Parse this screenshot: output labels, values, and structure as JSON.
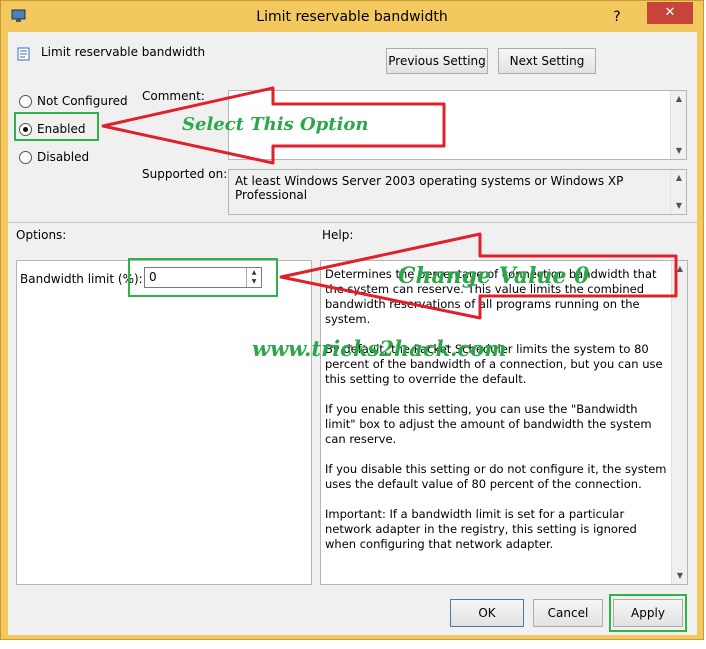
{
  "window": {
    "title": "Limit reservable bandwidth",
    "help_glyph": "?",
    "close_glyph": "✕"
  },
  "setting": {
    "name": "Limit reservable bandwidth"
  },
  "nav": {
    "previous_label": "Previous Setting",
    "next_label": "Next Setting"
  },
  "state": {
    "not_configured_label": "Not Configured",
    "enabled_label": "Enabled",
    "disabled_label": "Disabled",
    "selected": "Enabled"
  },
  "comment": {
    "label": "Comment:",
    "value": ""
  },
  "supported": {
    "label": "Supported on:",
    "value": "At least Windows Server 2003 operating systems or Windows XP Professional"
  },
  "options": {
    "label": "Options:",
    "bandwidth_label": "Bandwidth limit (%):",
    "bandwidth_value": "0"
  },
  "help": {
    "label": "Help:",
    "paragraphs": [
      "Determines the percentage of connection bandwidth that the system can reserve. This value limits the combined bandwidth reservations of all programs running on the system.",
      "By default, the Packet Scheduler limits the system to 80 percent of the bandwidth of a connection, but you can use this setting to override the default.",
      "If you enable this setting, you can use the \"Bandwidth limit\" box to adjust the amount of bandwidth the system can reserve.",
      "If you disable this setting or do not configure it, the system uses the default value of 80 percent of the connection.",
      "Important: If a bandwidth limit is set for a particular network adapter in the registry, this setting is ignored when configuring that network adapter."
    ]
  },
  "footer": {
    "ok_label": "OK",
    "cancel_label": "Cancel",
    "apply_label": "Apply"
  },
  "annotations": {
    "select_option": "Select This Option",
    "change_value": "Change Value 0",
    "watermark": "www.tricks2hack.com",
    "highlight_color": "#2db34a",
    "arrow_color": "#e0202a"
  }
}
